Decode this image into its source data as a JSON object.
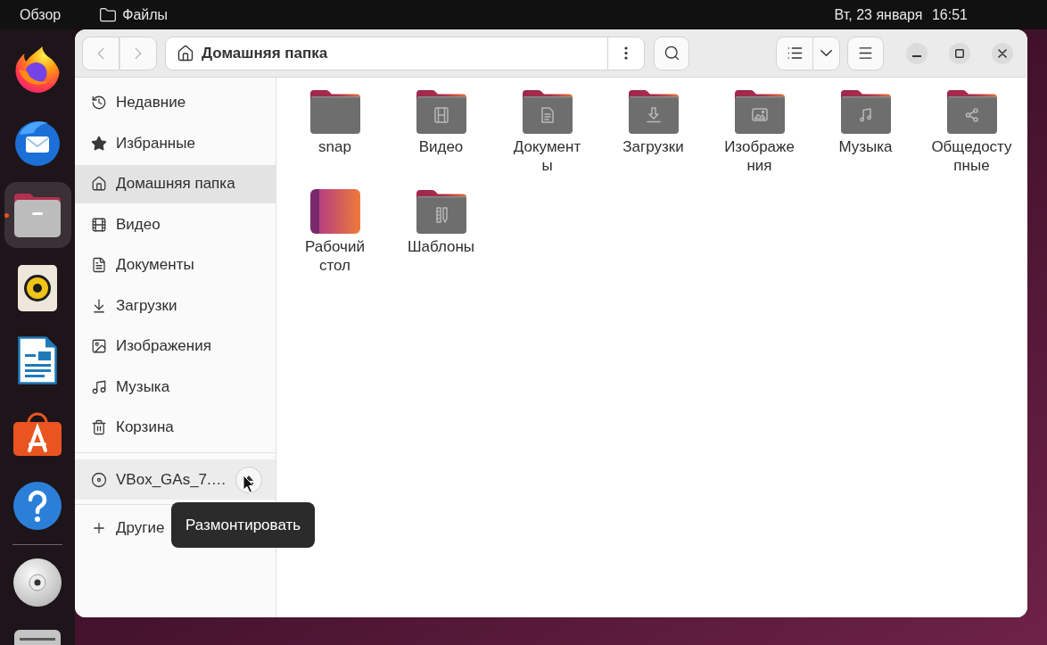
{
  "top_bar": {
    "overview": "Обзор",
    "app_name": "Файлы",
    "date": "Вт, 23 января",
    "time": "16:51"
  },
  "dock": {
    "apps": [
      {
        "kind": "browser",
        "selected": false,
        "running": false
      },
      {
        "kind": "mail",
        "selected": false,
        "running": false
      },
      {
        "kind": "files",
        "selected": true,
        "running": true
      },
      {
        "kind": "audio",
        "selected": false,
        "running": false
      },
      {
        "kind": "writer",
        "selected": false,
        "running": false
      },
      {
        "kind": "store",
        "selected": false,
        "running": false
      },
      {
        "kind": "help",
        "selected": false,
        "running": false
      }
    ],
    "devices": [
      {
        "kind": "disc"
      },
      {
        "kind": "drive"
      }
    ]
  },
  "header": {
    "back": {
      "disabled": true
    },
    "forward": {
      "disabled": true
    },
    "path": "Домашняя папка"
  },
  "sidebar": {
    "places": [
      {
        "label": "Недавние",
        "kind": "recent",
        "selected": false
      },
      {
        "label": "Избранные",
        "kind": "starred",
        "selected": false
      },
      {
        "label": "Домашняя папка",
        "kind": "home",
        "selected": true
      },
      {
        "label": "Видео",
        "kind": "video",
        "selected": false
      },
      {
        "label": "Документы",
        "kind": "documents",
        "selected": false
      },
      {
        "label": "Загрузки",
        "kind": "downloads",
        "selected": false
      },
      {
        "label": "Изображения",
        "kind": "pictures",
        "selected": false
      },
      {
        "label": "Музыка",
        "kind": "music",
        "selected": false
      },
      {
        "label": "Корзина",
        "kind": "trash",
        "selected": false
      }
    ],
    "devices": [
      {
        "label": "VBox_GAs_7.…",
        "kind": "disc",
        "hovered": true
      }
    ],
    "other": {
      "label": "Другие",
      "kind": "add"
    }
  },
  "files": [
    {
      "name": "snap",
      "kind": "folder"
    },
    {
      "name": "Видео",
      "kind": "video"
    },
    {
      "name": "Документ\nы",
      "kind": "document"
    },
    {
      "name": "Загрузки",
      "kind": "download"
    },
    {
      "name": "Изображе\nния",
      "kind": "image"
    },
    {
      "name": "Музыка",
      "kind": "music"
    },
    {
      "name": "Общедосту\nпные",
      "kind": "share"
    },
    {
      "name": "Рабочий стол",
      "kind": "desktop"
    },
    {
      "name": "Шаблоны",
      "kind": "templates"
    }
  ],
  "tooltip": {
    "text": "Размонтировать"
  }
}
